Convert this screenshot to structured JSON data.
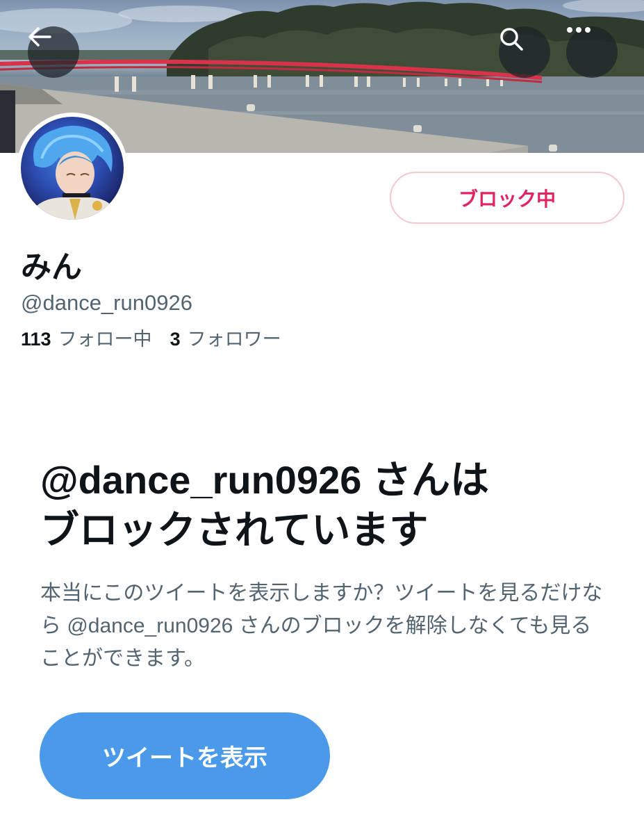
{
  "header": {
    "back_icon": "arrow-left-icon",
    "search_icon": "search-icon",
    "more_icon": "more-horizontal-icon"
  },
  "profile": {
    "display_name": "みん",
    "handle": "@dance_run0926",
    "following_count": "113",
    "following_label": "フォロー中",
    "followers_count": "3",
    "followers_label": "フォロワー",
    "blocked_button_label": "ブロック中"
  },
  "notice": {
    "title_line1": "@dance_run0926 さんは",
    "title_line2": "ブロックされています",
    "body": "本当にこのツイートを表示しますか？ツイートを見るだけなら @dance_run0926 さんのブロックを解除しなくても見ることができます。",
    "view_tweets_label": "ツイートを表示"
  },
  "colors": {
    "blocked_red": "#e0245e",
    "primary_blue": "#4a9ae9",
    "secondary_text": "#536471"
  }
}
